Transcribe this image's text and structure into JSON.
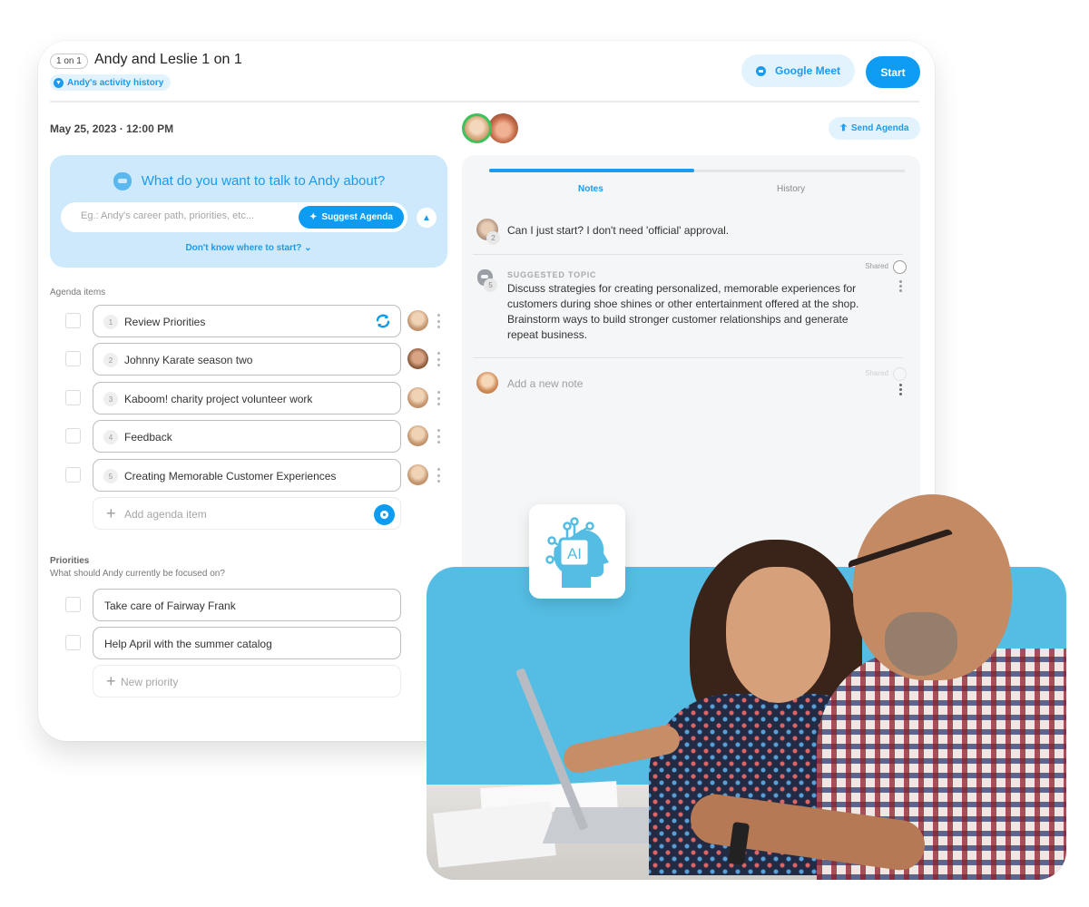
{
  "header": {
    "badge": "1 on 1",
    "title": "Andy and Leslie 1 on 1",
    "activity_history": "Andy's activity history",
    "google_meet_label": "Google Meet",
    "start_label": "Start"
  },
  "meeting": {
    "datetime": "May 25, 2023 · 12:00 PM",
    "send_agenda_label": "Send Agenda"
  },
  "talk_prompt": {
    "title": "What do you want to talk to Andy about?",
    "input_placeholder": "Eg.: Andy's career path, priorities, etc...",
    "input_value": "",
    "suggest_label": "Suggest Agenda",
    "dont_know_label": "Don't know where to start?"
  },
  "agenda": {
    "label": "Agenda items",
    "items": [
      {
        "number": "1",
        "text": "Review Priorities",
        "checked": false,
        "assignee": "Leslie"
      },
      {
        "number": "2",
        "text": "Johnny Karate season two",
        "checked": false,
        "assignee": "Andy"
      },
      {
        "number": "3",
        "text": "Kaboom! charity project volunteer work",
        "checked": false,
        "assignee": "Leslie"
      },
      {
        "number": "4",
        "text": "Feedback",
        "checked": false,
        "assignee": "Leslie"
      },
      {
        "number": "5",
        "text": "Creating Memorable Customer Experiences",
        "checked": false,
        "assignee": "Leslie"
      }
    ],
    "add_placeholder": "Add agenda item"
  },
  "priorities": {
    "label": "Priorities",
    "subtitle": "What should Andy currently be focused on?",
    "items": [
      {
        "text": "Take care of Fairway Frank",
        "checked": false
      },
      {
        "text": "Help April with the summer catalog",
        "checked": false
      }
    ],
    "add_placeholder": "New priority"
  },
  "notes_panel": {
    "tabs": [
      {
        "label": "Notes",
        "active": true
      },
      {
        "label": "History",
        "active": false
      }
    ],
    "notes": [
      {
        "text": "Can I just start? I don't need 'official' approval.",
        "count": "2"
      },
      {
        "tag": "SUGGESTED TOPIC",
        "count": "5",
        "text": "Discuss strategies for creating personalized, memorable experiences for customers during shoe shines or other entertainment offered at the shop. Brainstorm ways to build stronger customer relationships and generate repeat business.",
        "shared_label": "Shared",
        "shared": false
      }
    ],
    "new_note_placeholder": "Add a new note",
    "new_note_shared_label": "Shared"
  },
  "promo": {
    "ai_tile_text": "AI"
  },
  "colors": {
    "accent": "#0d9cf2",
    "accent_light": "#e3f3fd",
    "prompt_bg": "#cde9fb",
    "photo_bg": "#55bde3",
    "online_ring": "#3cc25a"
  }
}
